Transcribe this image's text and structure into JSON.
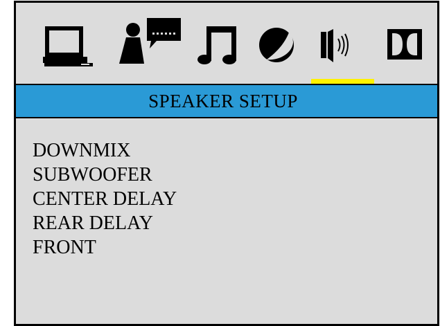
{
  "tabs": [
    {
      "name": "general-setup",
      "icon": "monitor-icon"
    },
    {
      "name": "language-setup",
      "icon": "person-speech-bubble-icon"
    },
    {
      "name": "audio-setup",
      "icon": "music-note-icon"
    },
    {
      "name": "video-setup",
      "icon": "color-circle-icon"
    },
    {
      "name": "speaker-setup",
      "icon": "speaker-icon",
      "selected": true
    },
    {
      "name": "dolby-setup",
      "icon": "dolby-double-d-icon"
    }
  ],
  "colors": {
    "background": "#dcdcdc",
    "title_bar": "#2a9ad6",
    "selection_underline": "#fff200",
    "text": "#000000"
  },
  "page": {
    "title": "SPEAKER SETUP"
  },
  "menu": {
    "items": [
      "DOWNMIX",
      "SUBWOOFER",
      "CENTER DELAY",
      "REAR DELAY",
      "FRONT"
    ]
  }
}
